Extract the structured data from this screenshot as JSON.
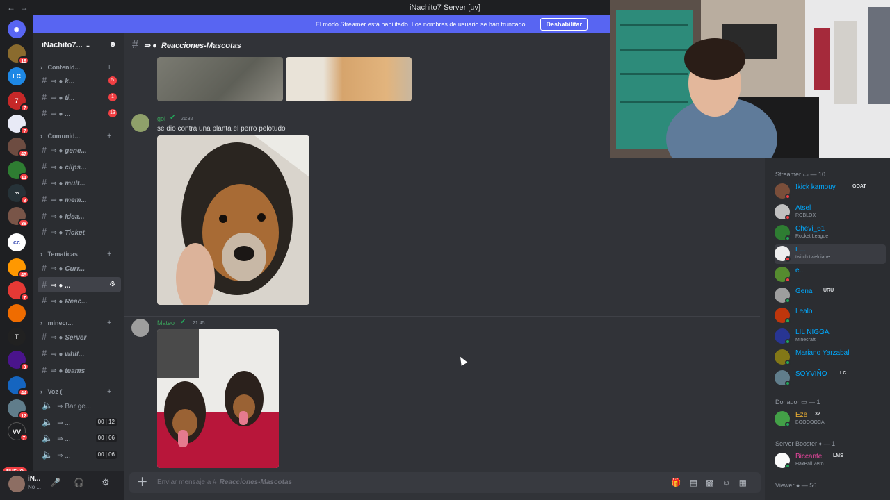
{
  "window": {
    "title": "iNachito7 Server [uv]"
  },
  "banner": {
    "text": "El modo Streamer está habilitado. Los nombres de usuario se han truncado.",
    "button": "Deshabilitar"
  },
  "server": {
    "name": "iNachito7..."
  },
  "rail": {
    "nuevo": "NUEVO",
    "badges": [
      "19",
      "7",
      "7",
      "47",
      "11",
      "8",
      "38",
      "45",
      "7",
      "3",
      "44",
      "12",
      "7"
    ]
  },
  "channel_list": {
    "categories": [
      {
        "label": "Contenid...",
        "top": 0
      },
      {
        "label": "Comunid...",
        "top": 0
      },
      {
        "label": "Tematicas",
        "top": 0
      },
      {
        "label": "minecr...",
        "top": 0
      },
      {
        "label": "Voz (",
        "top": 0
      }
    ],
    "channels": [
      {
        "name": "k...",
        "badge": "5"
      },
      {
        "name": "ti...",
        "badge": "1"
      },
      {
        "name": "...",
        "badge": "13"
      },
      {
        "name": "gene..."
      },
      {
        "name": "clips..."
      },
      {
        "name": "mult..."
      },
      {
        "name": "mem..."
      },
      {
        "name": "Idea..."
      },
      {
        "name": "Ticket"
      },
      {
        "name": "Curr..."
      },
      {
        "name": "..."
      },
      {
        "name": "Reac..."
      },
      {
        "name": "Server"
      },
      {
        "name": "whit..."
      },
      {
        "name": "teams"
      }
    ],
    "voice": [
      {
        "name": "Bar ge..."
      },
      {
        "name": "...",
        "a": "00",
        "b": "12"
      },
      {
        "name": "...",
        "a": "00",
        "b": "06"
      },
      {
        "name": "...",
        "a": "00",
        "b": "06"
      }
    ]
  },
  "user": {
    "name": "iN...",
    "status": "No ..."
  },
  "chat": {
    "channel_name": "Reacciones-Mascotas",
    "messages": [
      {
        "user": "gol",
        "time": "21:32",
        "text": "se dio contra una planta el perro pelotudo"
      },
      {
        "user": "Mateo",
        "time": "21:45",
        "text": ""
      }
    ],
    "composer_placeholder": "Enviar mensaje a #",
    "composer_channel": "Reacciones-Mascotas"
  },
  "members": {
    "groups": [
      {
        "label": "Streamer",
        "count": "— 10"
      },
      {
        "label": "Donador",
        "count": "— 1"
      },
      {
        "label": "Server Booster",
        "count": "— 1"
      },
      {
        "label": "Viewer",
        "count": "— 56"
      }
    ],
    "list": [
      {
        "name": "!kick kamouy",
        "activity": "",
        "tag": "GOAT",
        "color": "#00a8fc"
      },
      {
        "name": "Atsel",
        "activity": "ROBLOX",
        "tag": "",
        "color": "#00a8fc"
      },
      {
        "name": "Chevi_61",
        "activity": "Rocket League",
        "tag": "",
        "color": "#00a8fc"
      },
      {
        "name": "E...",
        "activity": "twitch.tv/elciane",
        "tag": "",
        "color": "#00a8fc"
      },
      {
        "name": "e...",
        "activity": "",
        "tag": "",
        "color": "#00a8fc"
      },
      {
        "name": "Gena",
        "activity": "",
        "tag": "URU",
        "color": "#00a8fc"
      },
      {
        "name": "Lealo",
        "activity": "",
        "tag": "",
        "color": "#00a8fc"
      },
      {
        "name": "LIL NIGGA",
        "activity": "Minecraft",
        "tag": "",
        "color": "#00a8fc"
      },
      {
        "name": "Mariano Yarzabal",
        "activity": "",
        "tag": "",
        "color": "#00a8fc"
      },
      {
        "name": "SOYVIÑO",
        "activity": "",
        "tag": "LC",
        "color": "#00a8fc"
      },
      {
        "name": "Eze",
        "activity": "BOOOOOCA",
        "tag": "32",
        "color": "#f0b232"
      },
      {
        "name": "Biccante",
        "activity": "HaxBall Zero",
        "tag": "LMS",
        "color": "#eb459f"
      }
    ]
  }
}
